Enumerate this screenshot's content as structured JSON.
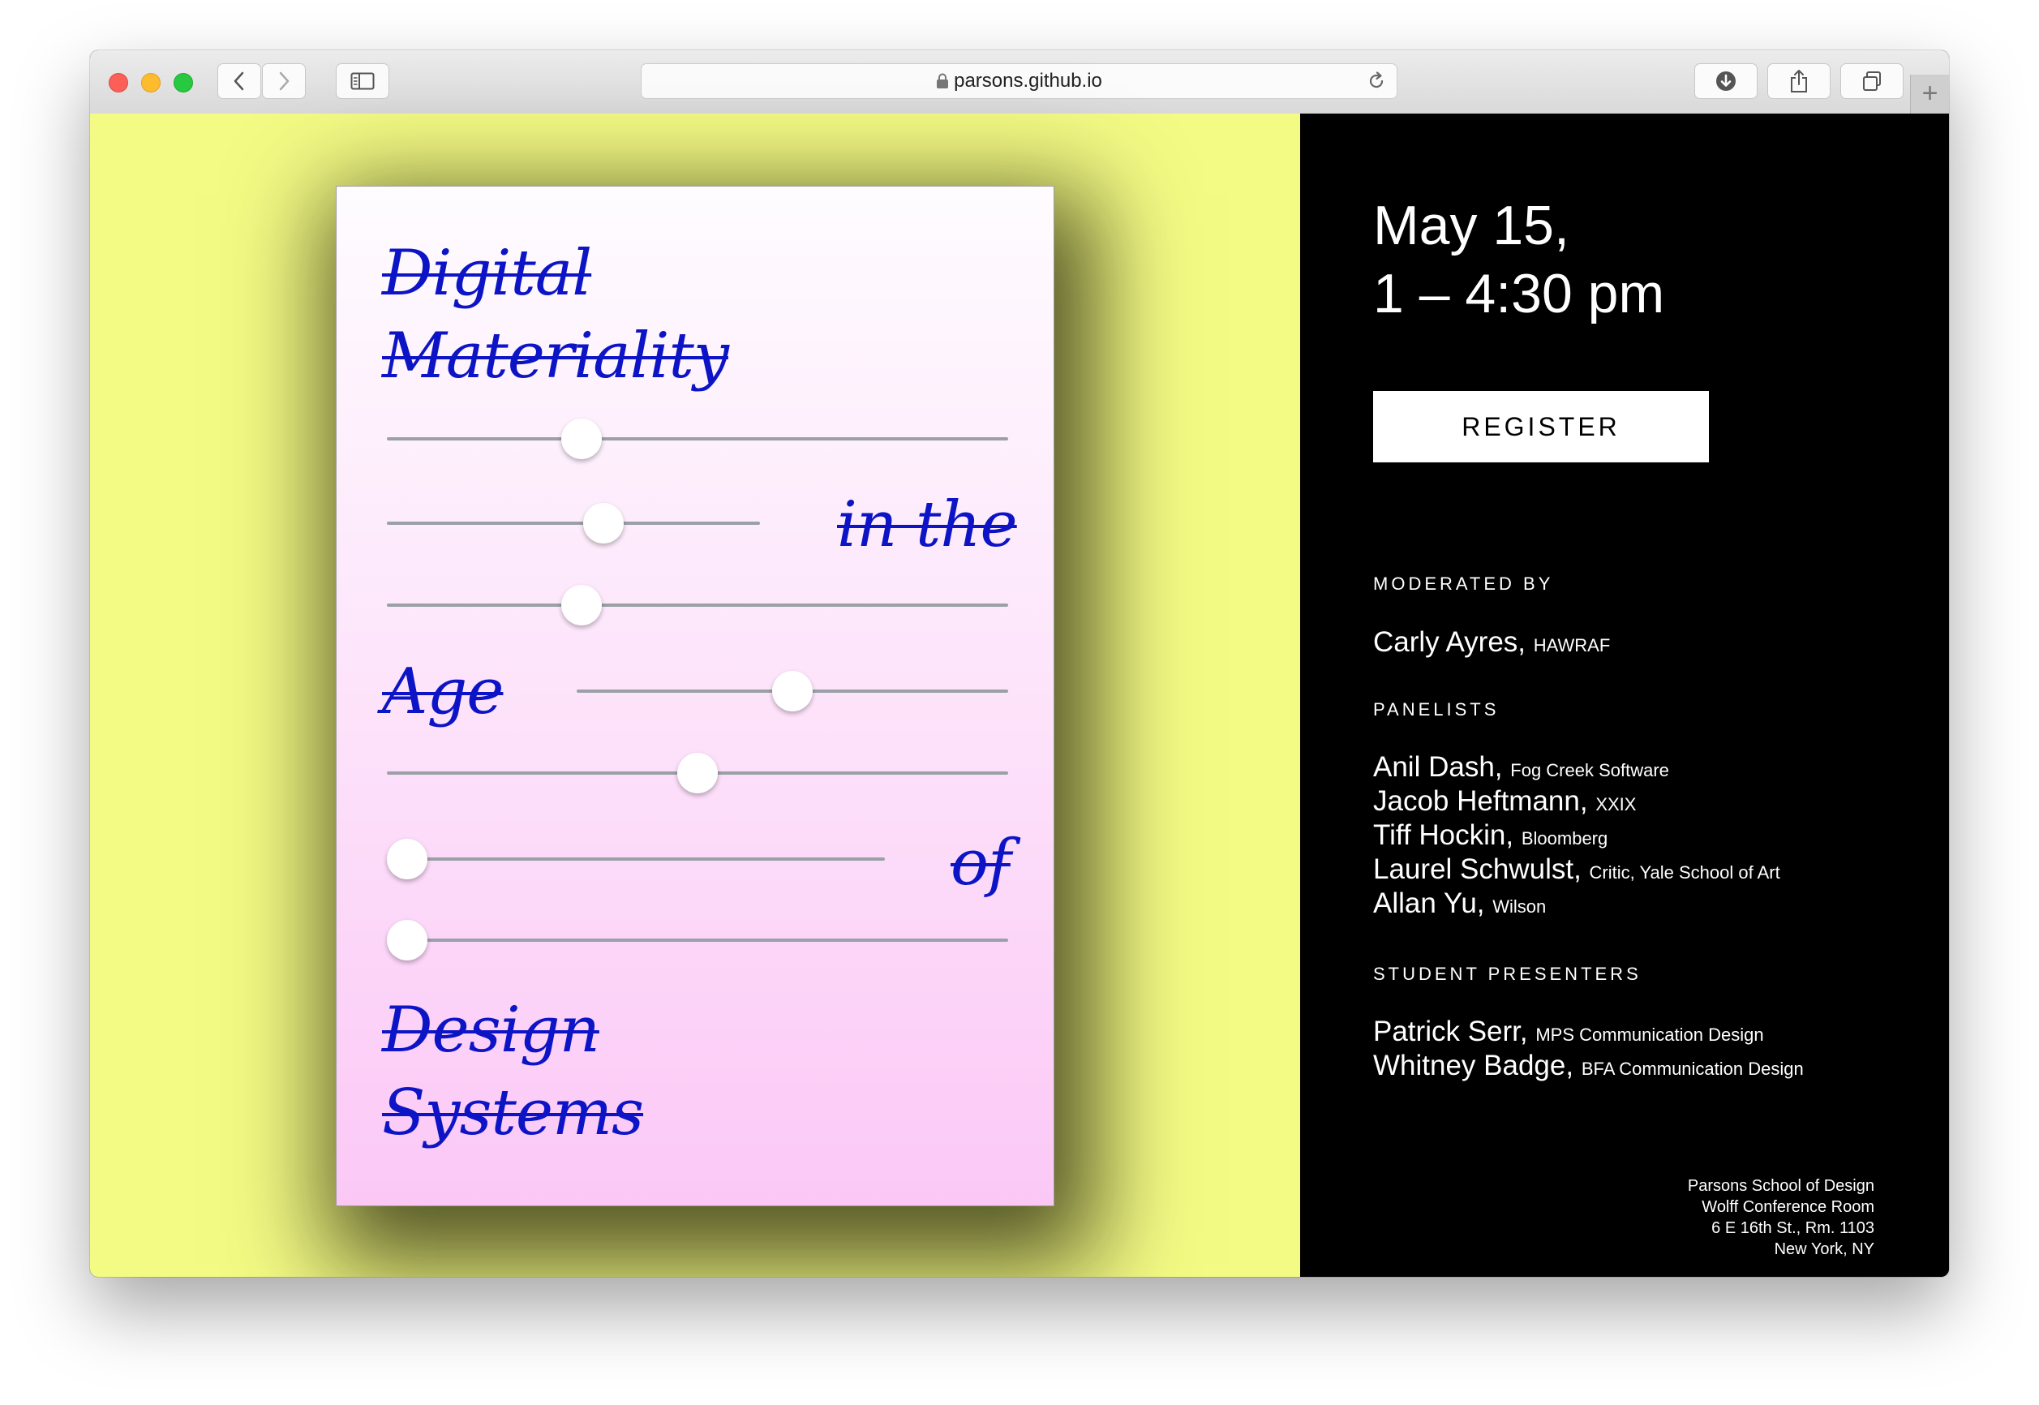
{
  "browser": {
    "url": "parsons.github.io",
    "new_tab_symbol": "+",
    "icons": [
      "back-icon",
      "forward-icon",
      "sidebar-icon",
      "lock-icon",
      "reload-icon",
      "download-icon",
      "share-icon",
      "tabs-icon"
    ]
  },
  "poster": {
    "lines": {
      "digital": "Digital",
      "materiality": "Materiality",
      "in_the": "in the",
      "age": "Age",
      "of": "of",
      "design": "Design",
      "systems": "Systems"
    },
    "text_color": "#0d14c6",
    "slider_levels": [
      0.3,
      0.59,
      0.3,
      0.5,
      0.5,
      0.0,
      0.0
    ]
  },
  "event": {
    "date_line1": "May 15,",
    "date_line2": "1 – 4:30 pm",
    "register_label": "REGISTER",
    "moderated_by_label": "MODERATED BY",
    "moderator": {
      "name": "Carly Ayres,",
      "affiliation": "HAWRAF"
    },
    "panelists_label": "PANELISTS",
    "panelists": [
      {
        "name": "Anil Dash,",
        "affiliation": "Fog Creek Software"
      },
      {
        "name": "Jacob Heftmann,",
        "affiliation": "XXIX"
      },
      {
        "name": "Tiff Hockin,",
        "affiliation": "Bloomberg"
      },
      {
        "name": "Laurel Schwulst,",
        "affiliation": "Critic, Yale School of Art"
      },
      {
        "name": "Allan Yu,",
        "affiliation": "Wilson"
      }
    ],
    "students_label": "STUDENT PRESENTERS",
    "students": [
      {
        "name": "Patrick Serr,",
        "affiliation": "MPS Communication Design"
      },
      {
        "name": "Whitney Badge,",
        "affiliation": "BFA Communication Design"
      }
    ],
    "venue": [
      "Parsons School of Design",
      "Wolff Conference Room",
      "6 E 16th St., Rm. 1103",
      "New York, NY"
    ]
  },
  "colors": {
    "left_background": "#f4fb84",
    "right_background": "#000000",
    "accent_blue": "#0d14c6"
  }
}
